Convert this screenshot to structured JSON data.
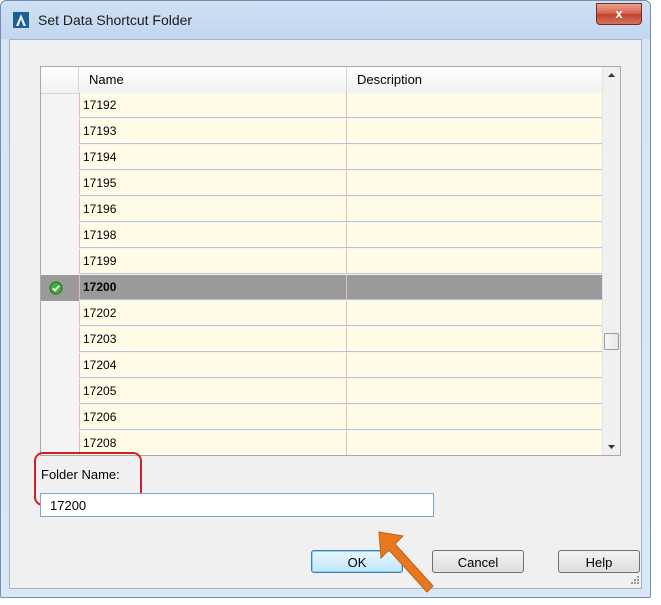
{
  "window": {
    "title": "Set Data Shortcut Folder",
    "close_label": "x"
  },
  "grid": {
    "columns": [
      "Name",
      "Description"
    ],
    "rows": [
      {
        "name": "17192",
        "description": "",
        "selected": false
      },
      {
        "name": "17193",
        "description": "",
        "selected": false
      },
      {
        "name": "17194",
        "description": "",
        "selected": false
      },
      {
        "name": "17195",
        "description": "",
        "selected": false
      },
      {
        "name": "17196",
        "description": "",
        "selected": false
      },
      {
        "name": "17198",
        "description": "",
        "selected": false
      },
      {
        "name": "17199",
        "description": "",
        "selected": false
      },
      {
        "name": "17200",
        "description": "",
        "selected": true
      },
      {
        "name": "17202",
        "description": "",
        "selected": false
      },
      {
        "name": "17203",
        "description": "",
        "selected": false
      },
      {
        "name": "17204",
        "description": "",
        "selected": false
      },
      {
        "name": "17205",
        "description": "",
        "selected": false
      },
      {
        "name": "17206",
        "description": "",
        "selected": false
      },
      {
        "name": "17208",
        "description": "",
        "selected": false
      }
    ]
  },
  "folder": {
    "label": "Folder Name:",
    "value": "17200"
  },
  "buttons": {
    "ok": "OK",
    "cancel": "Cancel",
    "help": "Help"
  },
  "icons": {
    "app": "autocad-a-icon",
    "check": "checkmark-icon",
    "pointer": "orange-arrow-icon"
  },
  "colors": {
    "selected_row": "#9a9a9a",
    "row_bg": "#fffbe6",
    "highlight": "#d11f2a",
    "arrow": "#e87722"
  }
}
